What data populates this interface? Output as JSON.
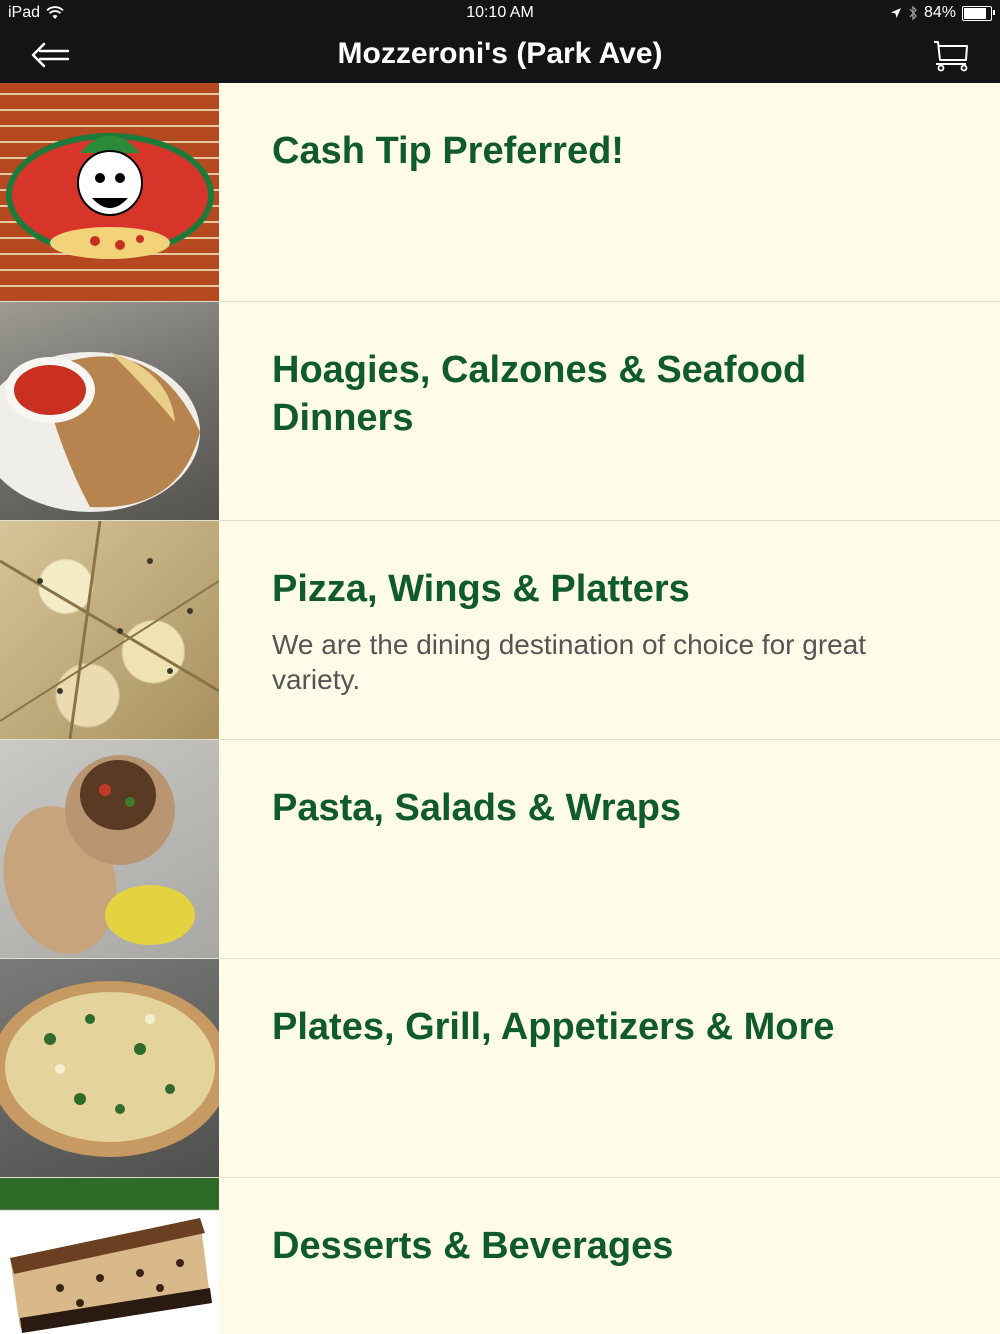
{
  "status_bar": {
    "device": "iPad",
    "time": "10:10 AM",
    "battery": "84%",
    "battery_level": 0.84
  },
  "nav": {
    "title": "Mozzeroni's (Park Ave)",
    "back_icon": "back-arrow-icon",
    "cart_icon": "cart-icon"
  },
  "categories": [
    {
      "title": "Cash Tip Preferred!",
      "desc": "",
      "image": "mozzeroni-logo"
    },
    {
      "title": "Hoagies, Calzones & Seafood Dinners",
      "desc": "",
      "image": "calzone-photo"
    },
    {
      "title": "Pizza, Wings & Platters",
      "desc": "We are the dining destination of choice for great variety.",
      "image": "white-pizza-photo"
    },
    {
      "title": "Pasta, Salads & Wraps",
      "desc": "",
      "image": "wrap-photo"
    },
    {
      "title": "Plates, Grill, Appetizers & More",
      "desc": "",
      "image": "flatbread-photo"
    },
    {
      "title": "Desserts & Beverages",
      "desc": "",
      "image": "cheesecake-photo"
    }
  ],
  "colors": {
    "bar_bg": "#141414",
    "list_bg": "#fefbe9",
    "title_green": "#0f5b2a"
  }
}
